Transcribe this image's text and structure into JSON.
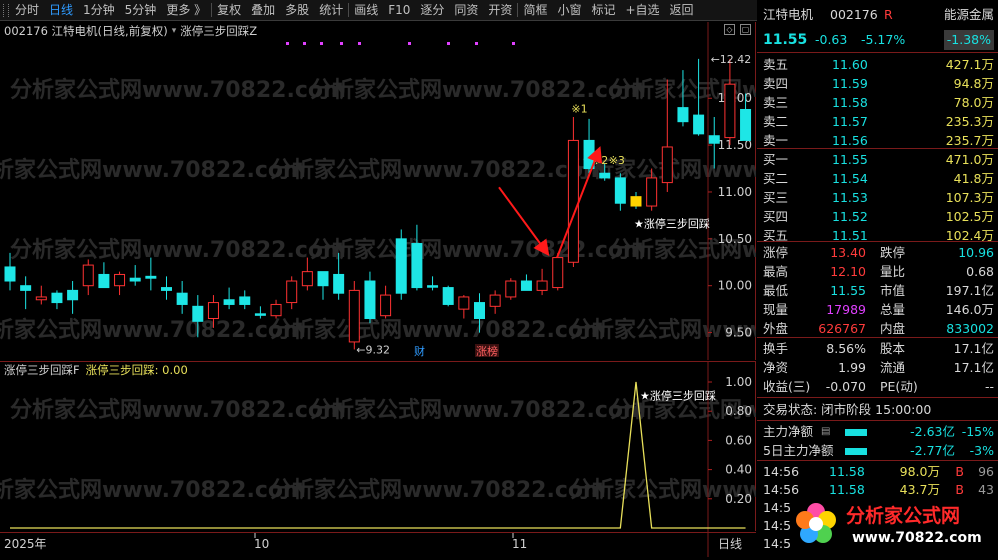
{
  "toolbar": {
    "items": [
      "分时",
      "日线",
      "1分钟",
      "5分钟",
      "更多 》",
      "复权",
      "叠加",
      "多股",
      "统计",
      "画线",
      "F10",
      "逐分",
      "同资",
      "开资",
      "简框",
      "小窗",
      "标记",
      "+自选",
      "返回"
    ],
    "active_index": 1
  },
  "main_chart": {
    "code_name": "002176 江特电机(日线,前复权)",
    "indicator_name": "涨停三步回踩Z",
    "y_ticks": [
      "12.00",
      "11.50",
      "11.00",
      "10.50",
      "10.00",
      "9.50"
    ],
    "high_label": "12.42",
    "low_label": "9.32",
    "markers": [
      "※1",
      "※2",
      "※3"
    ],
    "signal_label": "★涨停三步回踩",
    "event_tags": [
      "财",
      "涨榜"
    ],
    "watermark": "分析家公式网www.70822.com"
  },
  "chart_data": {
    "type": "candlestick",
    "ylim": [
      9.25,
      12.6
    ],
    "candles": [
      {
        "o": 10.05,
        "h": 10.35,
        "l": 9.95,
        "c": 10.2,
        "up": false
      },
      {
        "o": 9.95,
        "h": 10.1,
        "l": 9.75,
        "c": 10.0,
        "up": false
      },
      {
        "o": 9.85,
        "h": 10.0,
        "l": 9.8,
        "c": 9.88,
        "up": true
      },
      {
        "o": 9.82,
        "h": 9.95,
        "l": 9.75,
        "c": 9.92,
        "up": false
      },
      {
        "o": 9.85,
        "h": 10.05,
        "l": 9.7,
        "c": 9.95,
        "up": false
      },
      {
        "o": 10.0,
        "h": 10.28,
        "l": 9.9,
        "c": 10.22,
        "up": true
      },
      {
        "o": 10.12,
        "h": 10.25,
        "l": 9.98,
        "c": 9.98,
        "up": false
      },
      {
        "o": 10.0,
        "h": 10.15,
        "l": 9.9,
        "c": 10.12,
        "up": true
      },
      {
        "o": 10.08,
        "h": 10.22,
        "l": 10.0,
        "c": 10.05,
        "up": false
      },
      {
        "o": 10.08,
        "h": 10.3,
        "l": 9.95,
        "c": 10.1,
        "up": false
      },
      {
        "o": 9.98,
        "h": 10.1,
        "l": 9.85,
        "c": 9.95,
        "up": false
      },
      {
        "o": 9.92,
        "h": 10.05,
        "l": 9.7,
        "c": 9.8,
        "up": false
      },
      {
        "o": 9.78,
        "h": 9.9,
        "l": 9.45,
        "c": 9.62,
        "up": false
      },
      {
        "o": 9.65,
        "h": 9.9,
        "l": 9.55,
        "c": 9.82,
        "up": true
      },
      {
        "o": 9.85,
        "h": 9.98,
        "l": 9.75,
        "c": 9.8,
        "up": false
      },
      {
        "o": 9.8,
        "h": 9.95,
        "l": 9.75,
        "c": 9.88,
        "up": false
      },
      {
        "o": 9.7,
        "h": 9.78,
        "l": 9.65,
        "c": 9.7,
        "up": false
      },
      {
        "o": 9.68,
        "h": 9.85,
        "l": 9.65,
        "c": 9.8,
        "up": true
      },
      {
        "o": 9.82,
        "h": 10.1,
        "l": 9.75,
        "c": 10.05,
        "up": true
      },
      {
        "o": 10.15,
        "h": 10.3,
        "l": 9.95,
        "c": 10.0,
        "up": true
      },
      {
        "o": 10.0,
        "h": 10.15,
        "l": 9.85,
        "c": 10.15,
        "up": false
      },
      {
        "o": 10.12,
        "h": 10.35,
        "l": 9.85,
        "c": 9.92,
        "up": false
      },
      {
        "o": 9.95,
        "h": 10.05,
        "l": 9.32,
        "c": 9.4,
        "up": true
      },
      {
        "o": 10.05,
        "h": 10.15,
        "l": 9.6,
        "c": 9.65,
        "up": false
      },
      {
        "o": 9.68,
        "h": 10.0,
        "l": 9.65,
        "c": 9.9,
        "up": true
      },
      {
        "o": 9.92,
        "h": 10.6,
        "l": 9.85,
        "c": 10.5,
        "up": false
      },
      {
        "o": 10.45,
        "h": 10.65,
        "l": 9.95,
        "c": 9.98,
        "up": false
      },
      {
        "o": 10.0,
        "h": 10.1,
        "l": 9.95,
        "c": 10.0,
        "up": false
      },
      {
        "o": 9.98,
        "h": 10.0,
        "l": 9.78,
        "c": 9.8,
        "up": false
      },
      {
        "o": 9.75,
        "h": 9.9,
        "l": 9.65,
        "c": 9.88,
        "up": true
      },
      {
        "o": 9.82,
        "h": 9.92,
        "l": 9.5,
        "c": 9.65,
        "up": false
      },
      {
        "o": 9.78,
        "h": 9.95,
        "l": 9.7,
        "c": 9.9,
        "up": true
      },
      {
        "o": 9.88,
        "h": 10.08,
        "l": 9.85,
        "c": 10.05,
        "up": true
      },
      {
        "o": 10.05,
        "h": 10.12,
        "l": 9.98,
        "c": 9.95,
        "up": false
      },
      {
        "o": 9.95,
        "h": 10.18,
        "l": 9.9,
        "c": 10.05,
        "up": true
      },
      {
        "o": 9.98,
        "h": 10.35,
        "l": 9.95,
        "c": 10.3,
        "up": true
      },
      {
        "o": 10.25,
        "h": 11.8,
        "l": 10.2,
        "c": 11.55,
        "up": true
      },
      {
        "o": 11.55,
        "h": 11.78,
        "l": 11.2,
        "c": 11.25,
        "up": false
      },
      {
        "o": 11.2,
        "h": 11.3,
        "l": 11.12,
        "c": 11.15,
        "up": false
      },
      {
        "o": 11.15,
        "h": 11.2,
        "l": 10.8,
        "c": 10.88,
        "up": false
      },
      {
        "o": 10.95,
        "h": 11.0,
        "l": 10.82,
        "c": 10.85,
        "up": false
      },
      {
        "o": 10.85,
        "h": 11.25,
        "l": 10.8,
        "c": 11.15,
        "up": true
      },
      {
        "o": 11.1,
        "h": 12.2,
        "l": 11.0,
        "c": 11.48,
        "up": true
      },
      {
        "o": 11.9,
        "h": 12.3,
        "l": 11.7,
        "c": 11.75,
        "up": false
      },
      {
        "o": 11.82,
        "h": 12.42,
        "l": 11.6,
        "c": 11.62,
        "up": false
      },
      {
        "o": 11.6,
        "h": 11.8,
        "l": 11.25,
        "c": 11.52,
        "up": false
      },
      {
        "o": 11.58,
        "h": 12.42,
        "l": 11.5,
        "c": 12.15,
        "up": true
      },
      {
        "o": 11.88,
        "h": 12.05,
        "l": 11.55,
        "c": 11.55,
        "up": false
      }
    ],
    "highlight_index": 40,
    "sub_indicator": {
      "name": "涨停三步回踩F",
      "ylim": [
        0,
        1
      ],
      "y_ticks": [
        "1.00",
        "0.80",
        "0.60",
        "0.40",
        "0.20"
      ],
      "signal_index": 40,
      "values_nonzero": 1.0
    }
  },
  "sub_chart": {
    "name": "涨停三步回踩F",
    "value_label": "涨停三步回踩: 0.00",
    "signal_label": "★涨停三步回踩"
  },
  "time_axis": {
    "labels": [
      "2025年",
      "10",
      "11"
    ],
    "period": "日线"
  },
  "quote": {
    "name": "江特电机",
    "code": "002176",
    "tag": "R",
    "sector": "能源金属",
    "price": "11.55",
    "change": "-0.63",
    "change_pct": "-5.17%",
    "sector_pct": "-1.38%",
    "asks": [
      {
        "label": "卖五",
        "price": "11.60",
        "vol": "427.1万"
      },
      {
        "label": "卖四",
        "price": "11.59",
        "vol": "94.8万"
      },
      {
        "label": "卖三",
        "price": "11.58",
        "vol": "78.0万"
      },
      {
        "label": "卖二",
        "price": "11.57",
        "vol": "235.3万"
      },
      {
        "label": "卖一",
        "price": "11.56",
        "vol": "235.7万"
      }
    ],
    "bids": [
      {
        "label": "买一",
        "price": "11.55",
        "vol": "471.0万"
      },
      {
        "label": "买二",
        "price": "11.54",
        "vol": "41.8万"
      },
      {
        "label": "买三",
        "price": "11.53",
        "vol": "107.3万"
      },
      {
        "label": "买四",
        "price": "11.52",
        "vol": "102.5万"
      },
      {
        "label": "买五",
        "price": "11.51",
        "vol": "102.4万"
      }
    ],
    "stats": [
      {
        "l1": "涨停",
        "v1": "13.40",
        "l2": "跌停",
        "v2": "10.96"
      },
      {
        "l1": "最高",
        "v1": "12.10",
        "l2": "量比",
        "v2": "0.68"
      },
      {
        "l1": "最低",
        "v1": "11.55",
        "l2": "市值",
        "v2": "197.1亿"
      },
      {
        "l1": "现量",
        "v1": "17989",
        "l2": "总量",
        "v2": "146.0万"
      },
      {
        "l1": "外盘",
        "v1": "626767",
        "l2": "内盘",
        "v2": "833002"
      }
    ],
    "stats2": [
      {
        "l1": "换手",
        "v1": "8.56%",
        "l2": "股本",
        "v2": "17.1亿"
      },
      {
        "l1": "净资",
        "v1": "1.99",
        "l2": "流通",
        "v2": "17.1亿"
      },
      {
        "l1": "收益(三)",
        "v1": "-0.070",
        "l2": "PE(动)",
        "v2": "--"
      }
    ],
    "trade_state": "交易状态: 闭市阶段 15:00:00",
    "main_flow": {
      "label": "主力净额",
      "amount": "-2.63亿",
      "pct": "-15%"
    },
    "flow5": {
      "label": "5日主力净额",
      "amount": "-2.77亿",
      "pct": "-3%"
    },
    "ticks": [
      {
        "time": "14:56",
        "price": "11.58",
        "vol": "98.0万",
        "side": "B",
        "n": "96"
      },
      {
        "time": "14:56",
        "price": "11.58",
        "vol": "43.7万",
        "side": "B",
        "n": "43"
      },
      {
        "time": "14:5",
        "price": "",
        "vol": "",
        "side": "",
        "n": ""
      },
      {
        "time": "14:5",
        "price": "",
        "vol": "",
        "side": "",
        "n": ""
      },
      {
        "time": "14:5",
        "price": "",
        "vol": "",
        "side": "",
        "n": ""
      }
    ]
  },
  "logo": {
    "text": "分析家公式网",
    "url": "www.70822.com"
  },
  "colors": {
    "up": "#ff3232",
    "down": "#1ee6e6",
    "signal": "#ffffff",
    "yellow": "#e8e05a",
    "arrow": "#ff1a1a"
  }
}
